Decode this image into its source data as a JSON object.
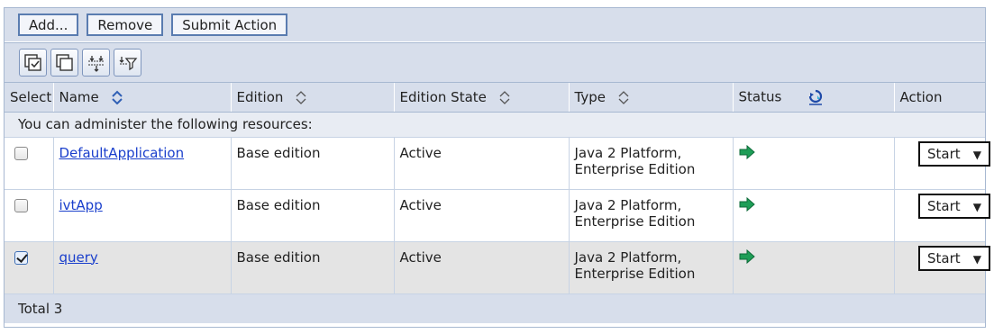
{
  "toolbar": {
    "add_label": "Add...",
    "remove_label": "Remove",
    "submit_label": "Submit Action"
  },
  "icon_buttons": [
    "select-all-icon",
    "deselect-all-icon",
    "expand-all-icon",
    "filter-icon"
  ],
  "columns": {
    "select": "Select",
    "name": "Name",
    "edition": "Edition",
    "edition_state": "Edition State",
    "type": "Type",
    "status": "Status",
    "action": "Action"
  },
  "info_text": "You can administer the following resources:",
  "rows": [
    {
      "name": "DefaultApplication",
      "edition": "Base edition",
      "state": "Active",
      "type_line1": "Java 2 Platform,",
      "type_line2": "Enterprise Edition",
      "action": "Start",
      "checked": false
    },
    {
      "name": "ivtApp",
      "edition": "Base edition",
      "state": "Active",
      "type_line1": "Java 2 Platform,",
      "type_line2": "Enterprise Edition",
      "action": "Start",
      "checked": false
    },
    {
      "name": "query",
      "edition": "Base edition",
      "state": "Active",
      "type_line1": "Java 2 Platform,",
      "type_line2": "Enterprise Edition",
      "action": "Start",
      "checked": true
    }
  ],
  "total_text": "Total 3",
  "colors": {
    "status_running": "#1e9e57",
    "header_bg": "#d7deeb",
    "link": "#1a3fcc"
  }
}
